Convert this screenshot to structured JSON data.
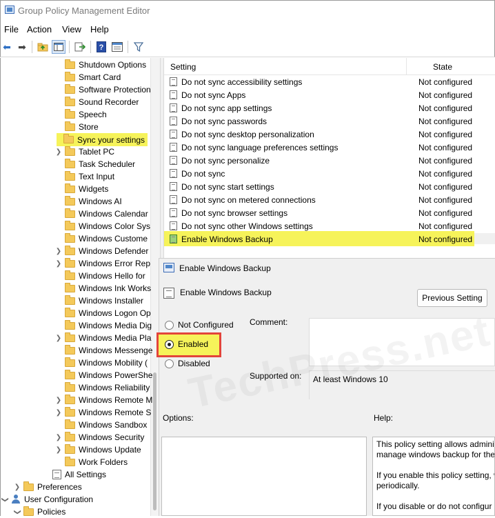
{
  "window": {
    "title": "Group Policy Management Editor"
  },
  "menu": [
    "File",
    "Action",
    "View",
    "Help"
  ],
  "toolbar": {
    "icons": [
      "back-arrow-icon",
      "forward-arrow-icon",
      "up-folder-icon",
      "show-hide-tree-icon",
      "export-list-icon",
      "help-icon",
      "properties-icon",
      "filter-icon"
    ]
  },
  "tree": {
    "items": [
      {
        "label": "Shutdown Options",
        "expandable": false,
        "highlight": false
      },
      {
        "label": "Smart Card",
        "expandable": false,
        "highlight": false
      },
      {
        "label": "Software Protection",
        "expandable": false,
        "highlight": false
      },
      {
        "label": "Sound Recorder",
        "expandable": false,
        "highlight": false
      },
      {
        "label": "Speech",
        "expandable": false,
        "highlight": false
      },
      {
        "label": "Store",
        "expandable": false,
        "highlight": false
      },
      {
        "label": "Sync your settings",
        "expandable": false,
        "highlight": true
      },
      {
        "label": "Tablet PC",
        "expandable": true,
        "highlight": false
      },
      {
        "label": "Task Scheduler",
        "expandable": false,
        "highlight": false
      },
      {
        "label": "Text Input",
        "expandable": false,
        "highlight": false
      },
      {
        "label": "Widgets",
        "expandable": false,
        "highlight": false
      },
      {
        "label": "Windows AI",
        "expandable": false,
        "highlight": false
      },
      {
        "label": "Windows Calendar",
        "expandable": false,
        "highlight": false
      },
      {
        "label": "Windows Color Sys",
        "expandable": false,
        "highlight": false
      },
      {
        "label": "Windows Custome",
        "expandable": false,
        "highlight": false
      },
      {
        "label": "Windows Defender",
        "expandable": true,
        "highlight": false
      },
      {
        "label": "Windows Error Rep",
        "expandable": true,
        "highlight": false
      },
      {
        "label": "Windows Hello for",
        "expandable": false,
        "highlight": false
      },
      {
        "label": "Windows Ink Works",
        "expandable": false,
        "highlight": false
      },
      {
        "label": "Windows Installer",
        "expandable": false,
        "highlight": false
      },
      {
        "label": "Windows Logon Op",
        "expandable": false,
        "highlight": false
      },
      {
        "label": "Windows Media Dig",
        "expandable": false,
        "highlight": false
      },
      {
        "label": "Windows Media Pla",
        "expandable": true,
        "highlight": false
      },
      {
        "label": "Windows Messenge",
        "expandable": false,
        "highlight": false
      },
      {
        "label": "Windows Mobility (",
        "expandable": false,
        "highlight": false
      },
      {
        "label": "Windows PowerShe",
        "expandable": false,
        "highlight": false
      },
      {
        "label": "Windows Reliability",
        "expandable": false,
        "highlight": false
      },
      {
        "label": "Windows Remote M",
        "expandable": true,
        "highlight": false
      },
      {
        "label": "Windows Remote S",
        "expandable": true,
        "highlight": false
      },
      {
        "label": "Windows Sandbox",
        "expandable": false,
        "highlight": false
      },
      {
        "label": "Windows Security",
        "expandable": true,
        "highlight": false
      },
      {
        "label": "Windows Update",
        "expandable": true,
        "highlight": false
      },
      {
        "label": "Work Folders",
        "expandable": false,
        "highlight": false
      }
    ],
    "all_settings": "All Settings",
    "preferences": "Preferences",
    "user_configuration": "User Configuration",
    "policies": "Policies"
  },
  "list": {
    "columns": {
      "setting": "Setting",
      "state": "State"
    },
    "rows": [
      {
        "name": "Do not sync accessibility settings",
        "state": "Not configured"
      },
      {
        "name": "Do not sync Apps",
        "state": "Not configured"
      },
      {
        "name": "Do not sync app settings",
        "state": "Not configured"
      },
      {
        "name": "Do not sync passwords",
        "state": "Not configured"
      },
      {
        "name": "Do not sync desktop personalization",
        "state": "Not configured"
      },
      {
        "name": "Do not sync language preferences settings",
        "state": "Not configured"
      },
      {
        "name": "Do not sync personalize",
        "state": "Not configured"
      },
      {
        "name": "Do not sync",
        "state": "Not configured"
      },
      {
        "name": "Do not sync start settings",
        "state": "Not configured"
      },
      {
        "name": "Do not sync on metered connections",
        "state": "Not configured"
      },
      {
        "name": "Do not sync browser settings",
        "state": "Not configured"
      },
      {
        "name": "Do not sync other Windows settings",
        "state": "Not configured"
      },
      {
        "name": "Enable Windows Backup",
        "state": "Not configured"
      }
    ],
    "highlighted_index": 12
  },
  "dialog": {
    "title": "Enable Windows Backup",
    "heading": "Enable Windows Backup",
    "previous_setting": "Previous Setting",
    "options": {
      "not_configured": "Not Configured",
      "enabled": "Enabled",
      "disabled": "Disabled",
      "selected": "enabled"
    },
    "comment_label": "Comment:",
    "supported_label": "Supported on:",
    "supported_value": "At least Windows 10",
    "options_label": "Options:",
    "help_label": "Help:",
    "help_lines": [
      "This policy setting allows admini",
      "manage windows backup for the",
      "",
      "If you enable this policy setting, w",
      "periodically.",
      "",
      "If you disable or do not configur"
    ]
  },
  "watermark": "TechPress.net",
  "colors": {
    "highlight": "#f6f35a",
    "callout_border": "#e3443a"
  }
}
